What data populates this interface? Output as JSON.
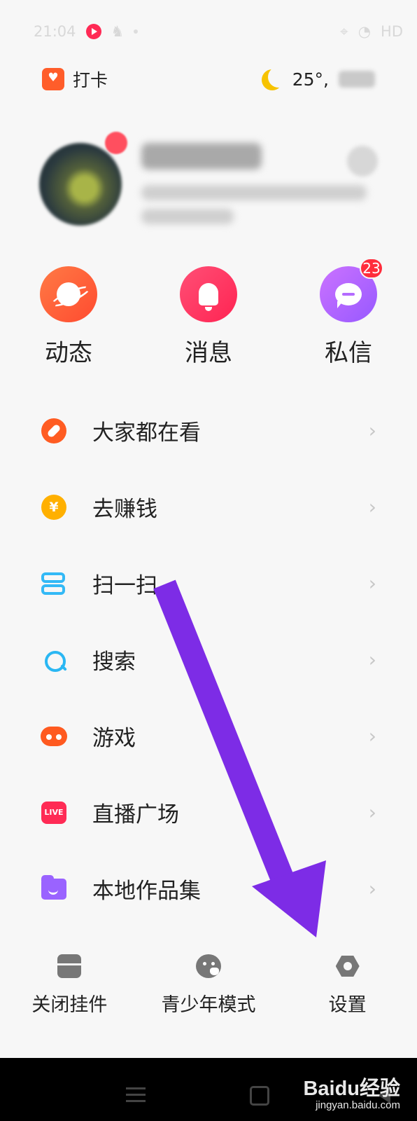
{
  "status_bar": {
    "time": "21:04",
    "network": "HD"
  },
  "header": {
    "checkin_label": "打卡",
    "temperature": "25°,"
  },
  "quick_actions": [
    {
      "label": "动态",
      "color": "#ff5a36"
    },
    {
      "label": "消息",
      "color": "#ff2f5c"
    },
    {
      "label": "私信",
      "color": "#b266ff",
      "badge": "23"
    }
  ],
  "menu": {
    "items": [
      {
        "label": "大家都在看",
        "icon": "compass-icon",
        "color": "#ff5c22"
      },
      {
        "label": "去赚钱",
        "icon": "yuan-coin-icon",
        "color": "#ffb000",
        "glyph": "¥"
      },
      {
        "label": "扫一扫",
        "icon": "scan-icon",
        "color": "#33b9f6"
      },
      {
        "label": "搜索",
        "icon": "search-icon",
        "color": "#2ab7f3"
      },
      {
        "label": "游戏",
        "icon": "gamepad-icon",
        "color": "#ff5a20"
      },
      {
        "label": "直播广场",
        "icon": "live-icon",
        "color": "#ff2b55",
        "badge_text": "LIVE"
      },
      {
        "label": "本地作品集",
        "icon": "folder-icon",
        "color": "#9a63ff"
      }
    ],
    "chevron": "›"
  },
  "bottom_tools": [
    {
      "label": "关闭挂件",
      "icon": "widget-icon"
    },
    {
      "label": "青少年模式",
      "icon": "teen-mode-icon"
    },
    {
      "label": "设置",
      "icon": "settings-gear-icon"
    }
  ],
  "watermark": {
    "main": "Baidu经验",
    "sub": "jingyan.baidu.com"
  },
  "annotation": {
    "arrow_color": "#7d2ce6"
  }
}
